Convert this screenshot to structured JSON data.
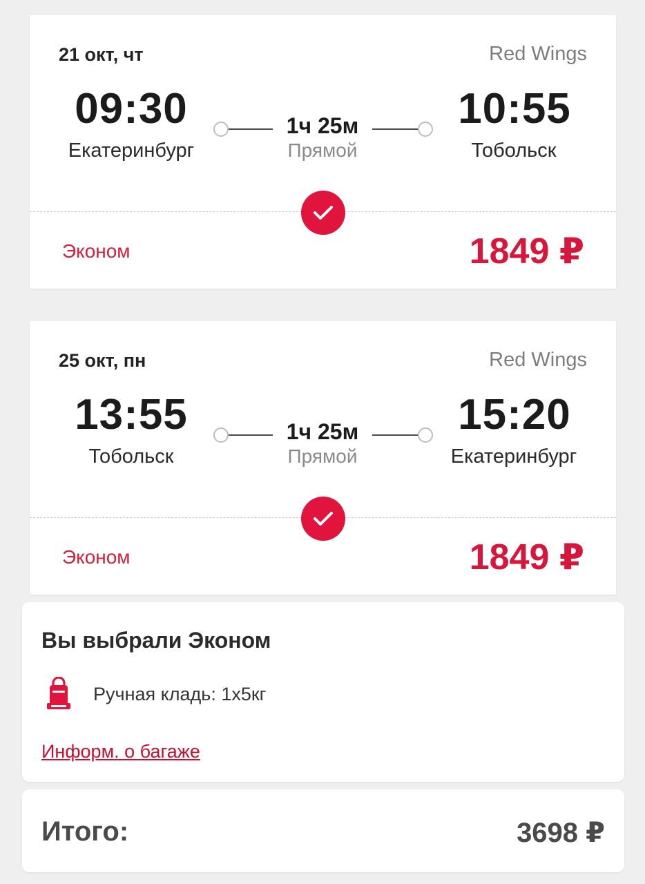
{
  "flights": [
    {
      "date": "21 окт, чт",
      "airline": "Red Wings",
      "departure_time": "09:30",
      "departure_city": "Екатеринбург",
      "arrival_time": "10:55",
      "arrival_city": "Тобольск",
      "duration": "1ч 25м",
      "type": "Прямой",
      "fare_class": "Эконом",
      "price": "1849 ₽",
      "selected": true
    },
    {
      "date": "25 окт, пн",
      "airline": "Red Wings",
      "departure_time": "13:55",
      "departure_city": "Тобольск",
      "arrival_time": "15:20",
      "arrival_city": "Екатеринбург",
      "duration": "1ч 25м",
      "type": "Прямой",
      "fare_class": "Эконом",
      "price": "1849 ₽",
      "selected": true
    }
  ],
  "selection": {
    "title": "Вы выбрали Эконом",
    "baggage_icon": "carry-on-bag-icon",
    "baggage_text": "Ручная кладь: 1х5кг",
    "baggage_link": "Информ. о багаже"
  },
  "total": {
    "label": "Итого:",
    "value": "3698 ₽"
  },
  "colors": {
    "accent": "#d6163a",
    "background": "#efefef",
    "card": "#ffffff"
  }
}
